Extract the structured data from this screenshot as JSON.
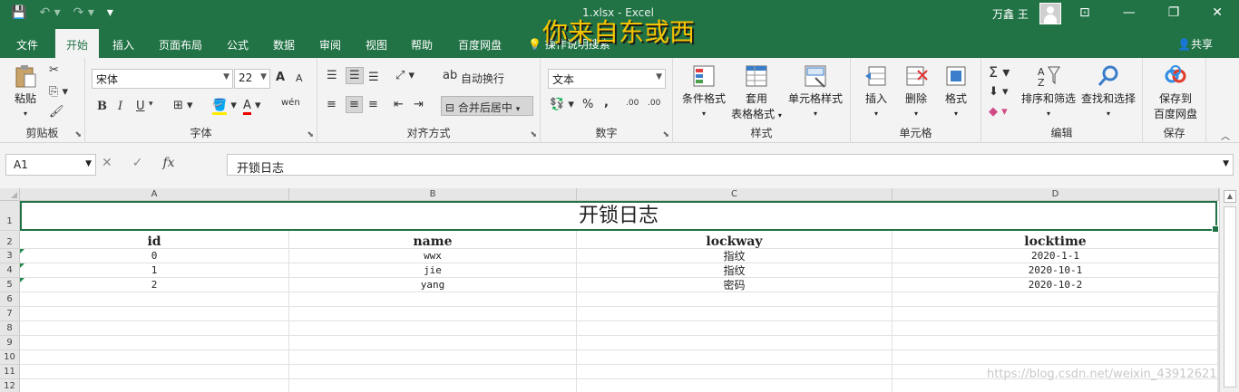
{
  "titlebar": {
    "qat": {
      "save": "💾",
      "undo": "↶ ▾",
      "redo": "↷ ▾",
      "customize": "▾"
    },
    "title": "1.xlsx  -  Excel",
    "user": "万鑫 王",
    "ribbon_display": "⊡",
    "minimize": "—",
    "restore": "❐",
    "close": "✕"
  },
  "overlay_text": "你来自东或西",
  "menu": {
    "items": [
      "文件",
      "开始",
      "插入",
      "页面布局",
      "公式",
      "数据",
      "审阅",
      "视图",
      "帮助",
      "百度网盘"
    ],
    "active": "开始",
    "tellme": "操作说明搜索",
    "share": "共享"
  },
  "ribbon": {
    "clipboard": {
      "label": "剪贴板",
      "paste": "粘贴"
    },
    "font": {
      "label": "字体",
      "name": "宋体",
      "size": "22",
      "bold": "B",
      "italic": "I",
      "underline": "U",
      "grow": "A",
      "shrink": "A",
      "phonetic": "wén"
    },
    "alignment": {
      "label": "对齐方式",
      "wrap": "自动换行",
      "merge": "合并后居中"
    },
    "number": {
      "label": "数字",
      "format": "文本",
      "percent": "%",
      "comma": ",",
      "inc_decimal": ".00",
      "dec_decimal": ".00"
    },
    "styles": {
      "label": "样式",
      "conditional": "条件格式",
      "table_line1": "套用",
      "table_line2": "表格格式",
      "cell_styles": "单元格样式"
    },
    "cells": {
      "label": "单元格",
      "insert": "插入",
      "delete": "删除",
      "format": "格式"
    },
    "editing": {
      "label": "编辑",
      "sort": "排序和筛选",
      "find": "查找和选择"
    },
    "save": {
      "label": "保存",
      "line1": "保存到",
      "line2": "百度网盘"
    }
  },
  "formula_bar": {
    "name_box": "A1",
    "fx": "fx",
    "cancel": "✕",
    "enter": "✓",
    "content": "开锁日志"
  },
  "sheet": {
    "columns": [
      "A",
      "B",
      "C",
      "D"
    ],
    "rows": [
      "1",
      "2",
      "3",
      "4",
      "5",
      "6",
      "7",
      "8",
      "9",
      "10",
      "11",
      "12"
    ],
    "title": "开锁日志",
    "headers": [
      "id",
      "name",
      "lockway",
      "locktime"
    ],
    "data": [
      [
        "0",
        "wwx",
        "指纹",
        "2020-1-1"
      ],
      [
        "1",
        "jie",
        "指纹",
        "2020-10-1"
      ],
      [
        "2",
        "yang",
        "密码",
        "2020-10-2"
      ]
    ]
  },
  "watermark": "https://blog.csdn.net/weixin_43912621"
}
